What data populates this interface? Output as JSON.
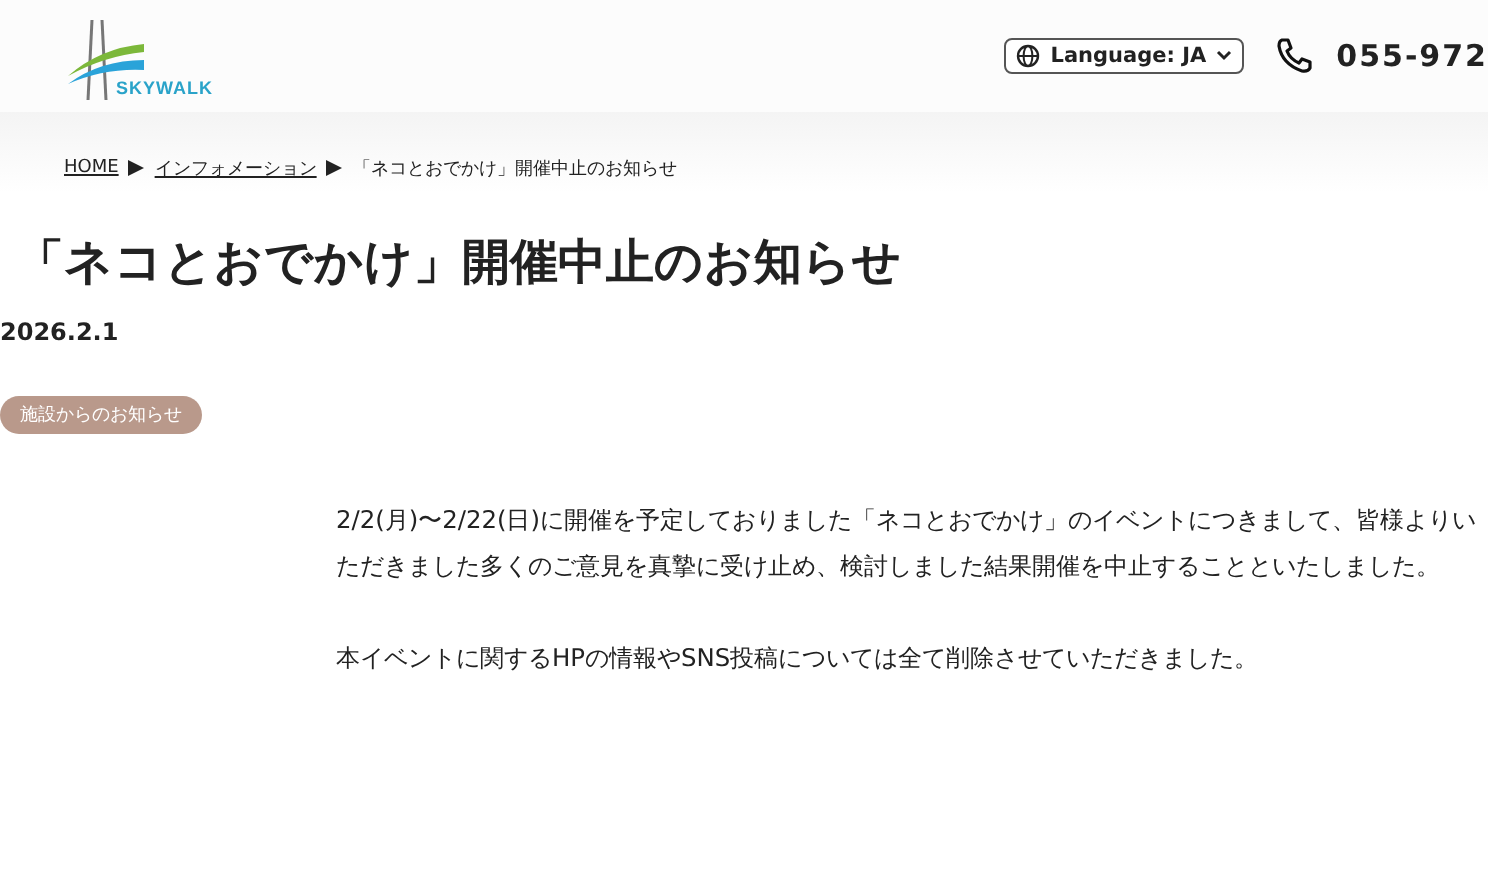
{
  "header": {
    "logo_text": "SKYWALK",
    "language": "Language: JA",
    "phone": "055-972"
  },
  "breadcrumb": [
    {
      "label": "HOME",
      "link": true
    },
    {
      "label": "インフォメーション",
      "link": true
    },
    {
      "label": "「ネコとおでかけ」開催中止のお知らせ",
      "link": false
    }
  ],
  "article": {
    "title": "「ネコとおでかけ」開催中止のお知らせ",
    "date": "2026.2.1",
    "category": "施設からのお知らせ",
    "paragraphs": [
      "2/2(月)〜2/22(日)に開催を予定しておりました「ネコとおでかけ」のイベントにつきまして、皆様よりいただきました多くのご意見を真摯に受け止め、検討しました結果開催を中止することといたしました。",
      "本イベントに関するHPの情報やSNS投稿については全て削除させていただきました。"
    ]
  }
}
